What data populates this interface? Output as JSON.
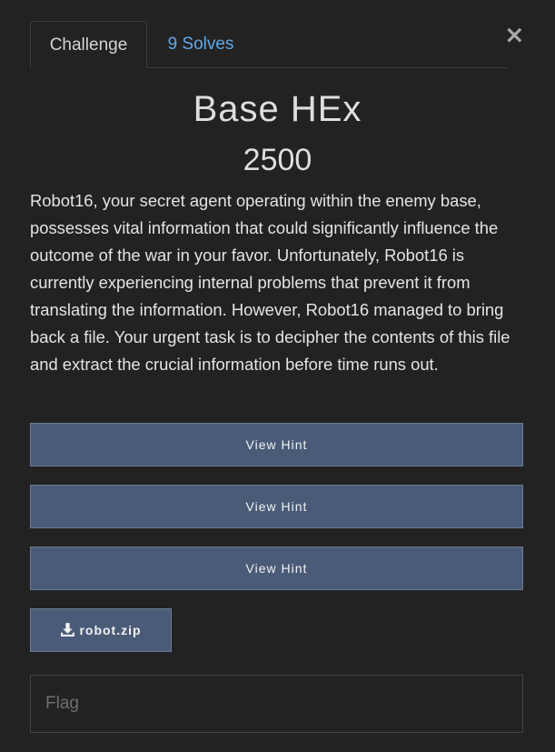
{
  "modal": {
    "close_label": "×",
    "tabs": [
      {
        "label": "Challenge"
      },
      {
        "label": "9 Solves"
      }
    ],
    "challenge": {
      "name": "Base HEx",
      "value": "2500",
      "description": "Robot16, your secret agent operating within the enemy base, possesses vital information that could significantly influence the outcome of the war in your favor. Unfortunately, Robot16 is currently experiencing internal problems that prevent it from translating the information. However, Robot16 managed to bring back a file. Your urgent task is to decipher the contents of this file and extract the crucial information before time runs out."
    },
    "hints": [
      {
        "label": "View Hint"
      },
      {
        "label": "View Hint"
      },
      {
        "label": "View Hint"
      }
    ],
    "files": [
      {
        "name": "robot.zip",
        "icon": "download-icon"
      }
    ],
    "flag_input": {
      "placeholder": "Flag",
      "value": ""
    }
  },
  "colors": {
    "background": "#222222",
    "button": "#4a5b78",
    "link": "#5fa8e8"
  }
}
